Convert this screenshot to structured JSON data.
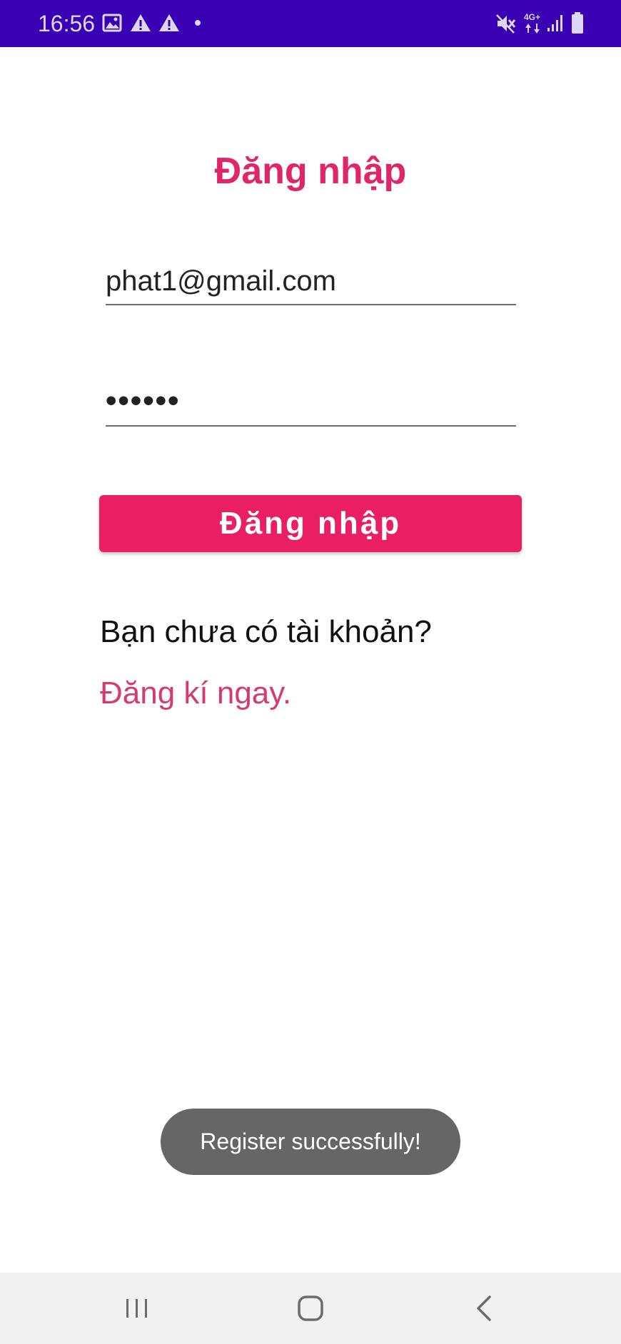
{
  "status_bar": {
    "time": "16:56",
    "left_icons": [
      "image-icon",
      "warning-icon",
      "warning-icon",
      "dot-icon"
    ],
    "right_icons": [
      "mute-icon",
      "network-4g-icon",
      "signal-icon",
      "battery-icon"
    ],
    "network_label": "4G+",
    "background_color": "#3a00b4"
  },
  "login": {
    "title": "Đăng nhập",
    "email_value": "phat1@gmail.com",
    "password_value": "••••••",
    "button_label": "Đăng nhập",
    "accent_color": "#ea1f63"
  },
  "register_prompt": {
    "question": "Bạn chưa có tài khoản?",
    "link": "Đăng kí ngay."
  },
  "toast": {
    "message": "Register successfully!"
  },
  "nav_bar": {
    "buttons": [
      "recent-apps-icon",
      "home-icon",
      "back-icon"
    ]
  }
}
